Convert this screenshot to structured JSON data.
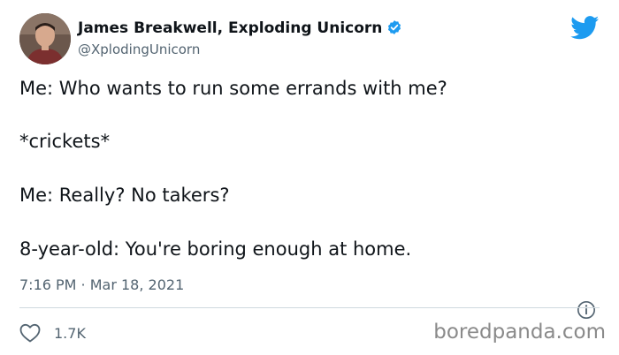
{
  "author": {
    "display_name": "James Breakwell, Exploding Unicorn",
    "handle": "@XplodingUnicorn",
    "verified": true
  },
  "tweet": {
    "lines": [
      "Me: Who wants to run some errands with me?",
      "*crickets*",
      "Me: Really? No takers?",
      "8-year-old: You're boring enough at home."
    ],
    "timestamp": "7:16 PM · Mar 18, 2021"
  },
  "actions": {
    "like_count": "1.7K"
  },
  "watermark": "boredpanda.com",
  "colors": {
    "twitter_blue": "#1d9bf0",
    "secondary_text": "#536471"
  },
  "icons": [
    "avatar",
    "verified-badge-icon",
    "twitter-bird-icon",
    "info-icon",
    "heart-icon"
  ]
}
